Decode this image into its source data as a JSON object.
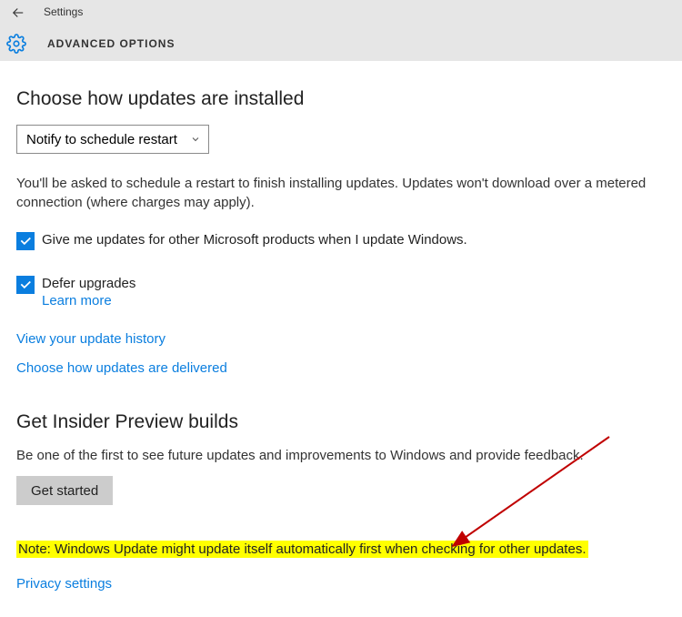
{
  "header": {
    "app_title": "Settings",
    "page_title": "ADVANCED OPTIONS"
  },
  "updates": {
    "heading": "Choose how updates are installed",
    "dropdown_value": "Notify to schedule restart",
    "description": "You'll be asked to schedule a restart to finish installing updates. Updates won't download over a metered connection (where charges may apply).",
    "cb1_label": "Give me updates for other Microsoft products when I update Windows.",
    "cb1_checked": true,
    "cb2_label": "Defer upgrades",
    "cb2_checked": true,
    "learn_more": "Learn more",
    "history_link": "View your update history",
    "delivery_link": "Choose how updates are delivered"
  },
  "insider": {
    "heading": "Get Insider Preview builds",
    "description": "Be one of the first to see future updates and improvements to Windows and provide feedback.",
    "button": "Get started"
  },
  "note": "Note: Windows Update might update itself automatically first when checking for other updates.",
  "privacy_link": "Privacy settings",
  "icons": {
    "back": "back-arrow",
    "gear": "settings-gear",
    "chevron": "chevron-down",
    "check": "check"
  }
}
